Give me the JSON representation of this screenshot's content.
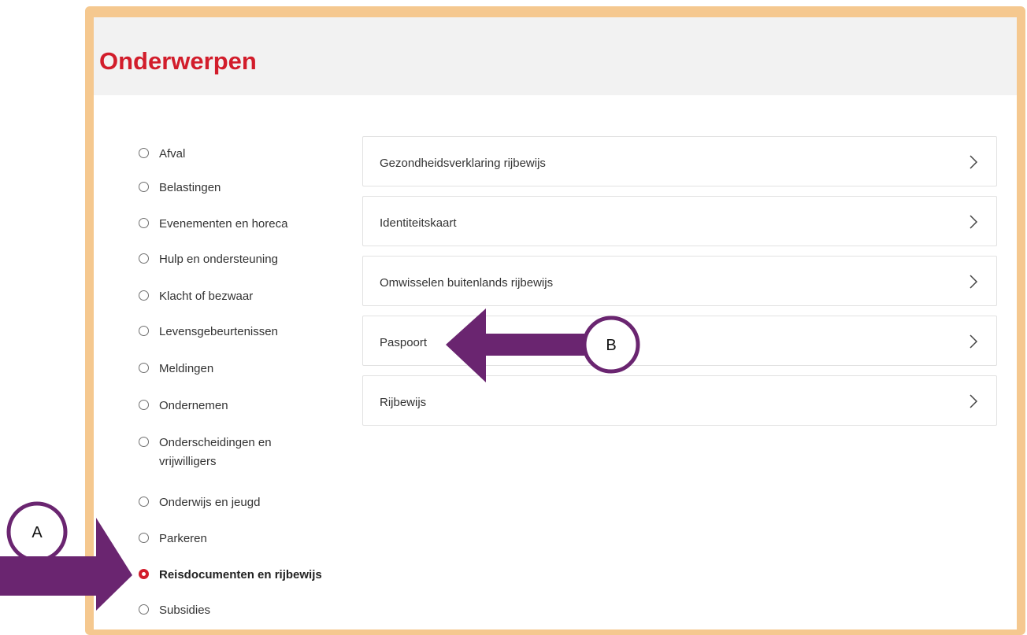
{
  "page": {
    "title": "Onderwerpen"
  },
  "topics": [
    {
      "label": "Afval",
      "selected": false
    },
    {
      "label": "Belastingen",
      "selected": false
    },
    {
      "label": "Evenementen en horeca",
      "selected": false
    },
    {
      "label": "Hulp en ondersteuning",
      "selected": false
    },
    {
      "label": "Klacht of bezwaar",
      "selected": false
    },
    {
      "label": "Levensgebeurtenissen",
      "selected": false
    },
    {
      "label": "Meldingen",
      "selected": false
    },
    {
      "label": "Ondernemen",
      "selected": false
    },
    {
      "label": "Onderscheidingen en vrijwilligers",
      "selected": false
    },
    {
      "label": "Onderwijs en jeugd",
      "selected": false
    },
    {
      "label": "Parkeren",
      "selected": false
    },
    {
      "label": "Reisdocumenten en rijbewijs",
      "selected": true
    },
    {
      "label": "Subsidies",
      "selected": false
    }
  ],
  "items": [
    {
      "label": "Gezondheidsverklaring rijbewijs"
    },
    {
      "label": "Identiteitskaart"
    },
    {
      "label": "Omwisselen buitenlands rijbewijs"
    },
    {
      "label": "Paspoort"
    },
    {
      "label": "Rijbewijs"
    }
  ],
  "annotations": {
    "a": {
      "label": "A"
    },
    "b": {
      "label": "B"
    },
    "arrow_color": "#6a2570"
  },
  "colors": {
    "accent": "#d21d2b",
    "frame": "#f5c88f",
    "header_bg": "#f2f2f2"
  }
}
